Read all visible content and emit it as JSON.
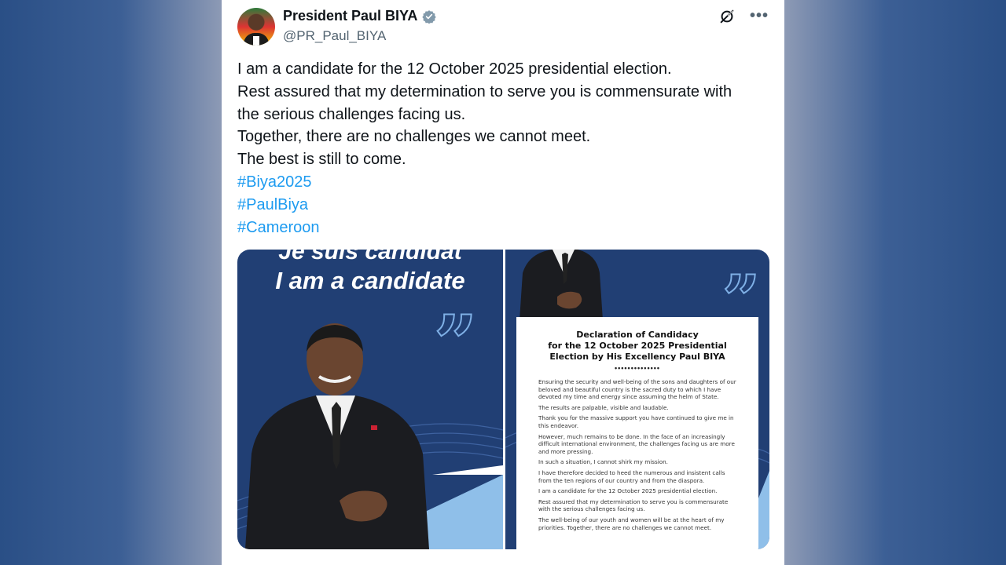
{
  "author": {
    "display_name": "President Paul BIYA",
    "handle": "@PR_Paul_BIYA"
  },
  "tweet": {
    "lines": [
      "I am a candidate for the 12 October 2025 presidential election.",
      "Rest assured that my determination to serve you is commensurate with",
      "the serious challenges facing us.",
      "Together, there are no challenges we cannot meet.",
      "The best is still to come."
    ],
    "hashtags": [
      "#Biya2025",
      "#PaulBiya",
      "#Cameroon"
    ]
  },
  "media": {
    "left": {
      "french_heading": "Je suis candidat",
      "english_heading": "I am a candidate"
    },
    "right": {
      "doc_title_lines": [
        "Declaration of Candidacy",
        "for the 12 October 2025 Presidential",
        "Election by His Excellency Paul BIYA"
      ],
      "doc_separator": "••••••••••••••",
      "doc_paragraphs": [
        "Ensuring the security and well-being of the sons and daughters of our beloved and beautiful country is the sacred duty to which I have devoted my time and energy since assuming the helm of State.",
        "The results are palpable, visible and laudable.",
        "Thank you for the massive support you have continued to give me in this endeavor.",
        "However, much remains to be done. In the face of an increasingly difficult international environment, the challenges facing us are more and more pressing.",
        "In such a situation, I cannot shirk my mission.",
        "I have therefore decided to heed the numerous and insistent calls from the ten regions of our country and from the diaspora.",
        "I am a candidate for the 12 October 2025 presidential election.",
        "Rest assured that my determination to serve you is commensurate with the serious challenges facing us.",
        "The well-being of our youth and women will be at the heart of my priorities. Together, there are no challenges we cannot meet."
      ]
    }
  },
  "icons": {
    "verified": "verified-badge-icon",
    "grok": "grok-icon",
    "more": "more-options-icon"
  },
  "colors": {
    "hashtag": "#1d9bf0",
    "text": "#0f1419",
    "secondary": "#536471",
    "media_blue": "#213f74",
    "verified": "#829aab"
  }
}
